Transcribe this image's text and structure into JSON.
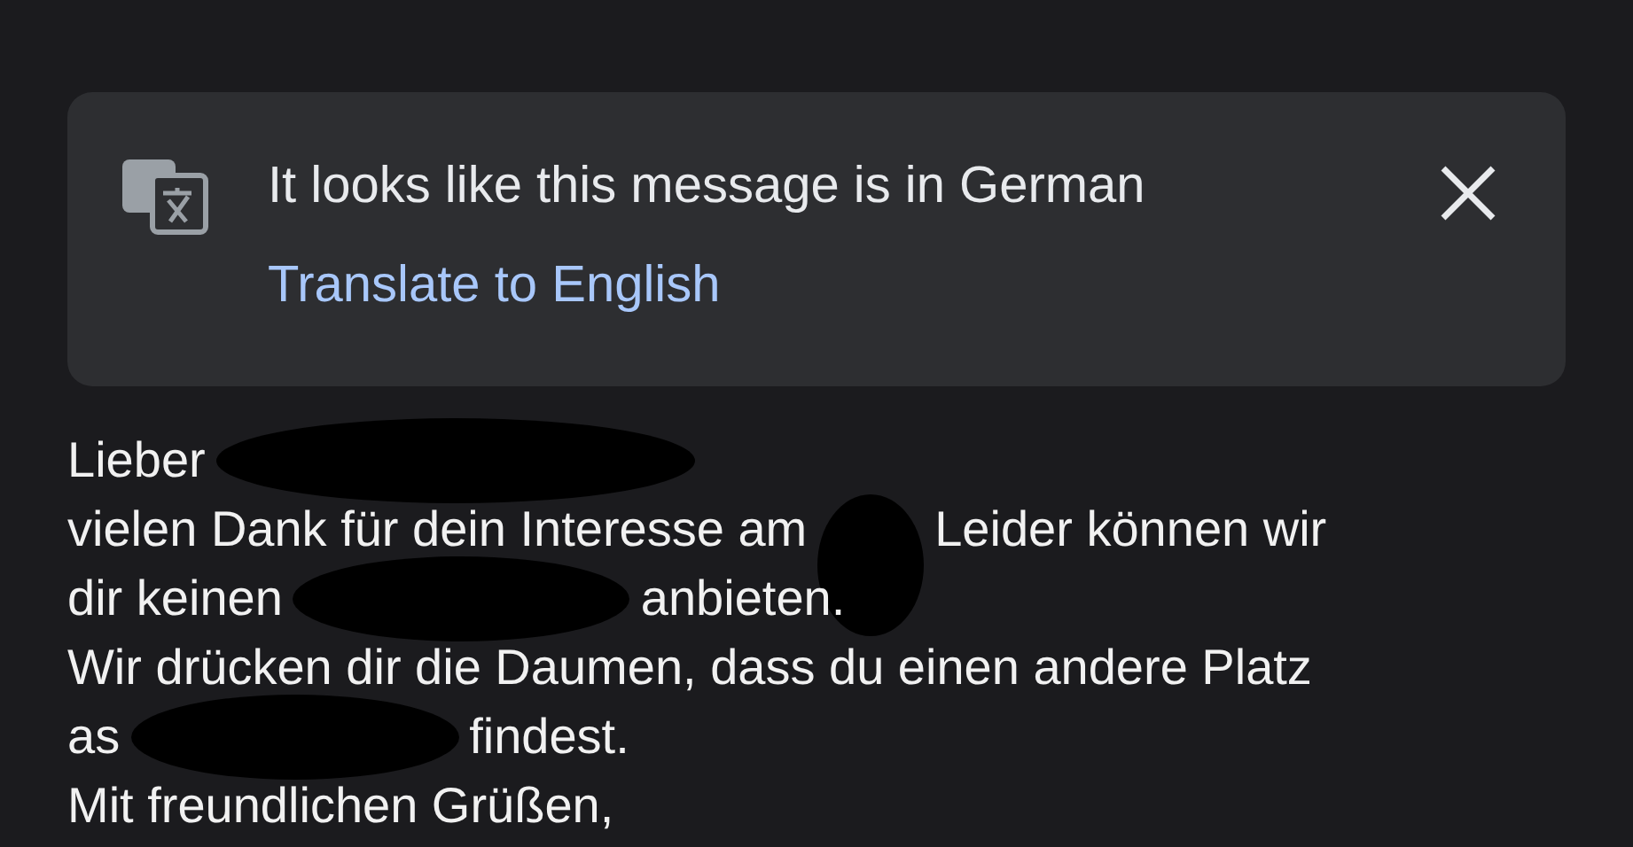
{
  "banner": {
    "title": "It looks like this message is in German",
    "action": "Translate to English"
  },
  "body": [
    [
      {
        "kind": "text",
        "text": "Lieber"
      },
      {
        "kind": "redaction"
      }
    ],
    [
      {
        "kind": "text",
        "text": "vielen Dank für dein Interesse am"
      },
      {
        "kind": "redaction"
      },
      {
        "kind": "text",
        "text": "Leider können wir"
      }
    ],
    [
      {
        "kind": "text",
        "text": "dir keinen"
      },
      {
        "kind": "redaction"
      },
      {
        "kind": "text",
        "text": "anbieten."
      }
    ],
    [
      {
        "kind": "text",
        "text": "Wir drücken dir die Daumen, dass du einen andere Platz"
      }
    ],
    [
      {
        "kind": "text",
        "text": "as"
      },
      {
        "kind": "redaction"
      },
      {
        "kind": "text",
        "text": "findest."
      }
    ],
    [
      {
        "kind": "text",
        "text": "Mit freundlichen Grüßen,"
      }
    ]
  ]
}
